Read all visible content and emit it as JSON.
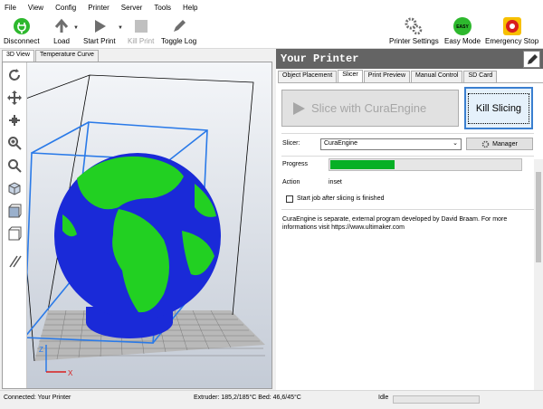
{
  "menu": [
    "File",
    "View",
    "Config",
    "Printer",
    "Server",
    "Tools",
    "Help"
  ],
  "toolbar": {
    "connect": "Disconnect",
    "load": "Load",
    "start": "Start Print",
    "kill": "Kill Print",
    "log": "Toggle Log",
    "printer_settings": "Printer Settings",
    "easy_mode": "Easy Mode",
    "easy_badge": "EASY",
    "emergency": "Emergency Stop"
  },
  "view_tabs": [
    "3D View",
    "Temperature Curve"
  ],
  "printer_title": "Your Printer",
  "right_tabs": [
    "Object Placement",
    "Slicer",
    "Print Preview",
    "Manual Control",
    "SD Card"
  ],
  "slicer": {
    "slice_button": "Slice with CuraEngine",
    "kill_button": "Kill Slicing",
    "slicer_label": "Slicer:",
    "slicer_value": "CuraEngine",
    "manager_button": "Manager",
    "progress_label": "Progress",
    "progress_value": 0.34,
    "action_label": "Action",
    "action_value": "inset",
    "checkbox_label": "Start job after slicing is finished",
    "checkbox_checked": false,
    "info": "CuraEngine is separate, external program developed by David Braam. For more informations visit https://www.ultimaker.com"
  },
  "axis": {
    "x": "X",
    "z": "Z"
  },
  "status": {
    "connection": "Connected: Your Printer",
    "temps": "Extruder: 185,2/185°C Bed: 46,6/45°C",
    "state": "Idle"
  },
  "colors": {
    "accent": "#06b025",
    "header": "#646464",
    "globe_land": "#22d022",
    "globe_water": "#1a2ad8",
    "frame": "#2a7ae8"
  }
}
